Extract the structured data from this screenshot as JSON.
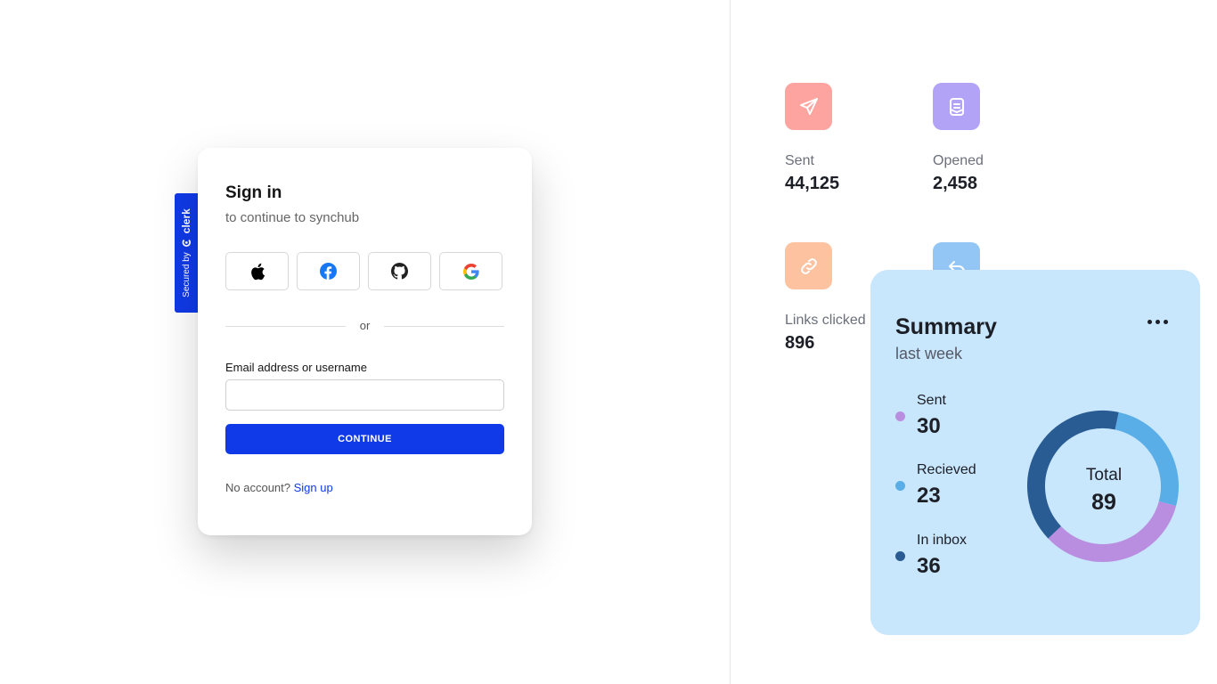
{
  "auth": {
    "badge": {
      "prefix": "Secured by",
      "brand": "clerk"
    },
    "title": "Sign in",
    "subtitle": "to continue to synchub",
    "social_providers": [
      {
        "name": "apple-icon"
      },
      {
        "name": "facebook-icon"
      },
      {
        "name": "github-icon"
      },
      {
        "name": "google-icon"
      }
    ],
    "divider_text": "or",
    "email_label": "Email address or username",
    "email_value": "",
    "continue_label": "CONTINUE",
    "no_account_text": "No account?",
    "signup_link": "Sign up",
    "colors": {
      "primary": "#103ae8"
    }
  },
  "stats": [
    {
      "label": "Sent",
      "value": "44,125",
      "icon": "paper-plane-icon",
      "color": "#fda4a1"
    },
    {
      "label": "Opened",
      "value": "2,458",
      "icon": "open-mail-icon",
      "color": "#b2a3f7"
    },
    {
      "label": "Links clicked",
      "value": "896",
      "icon": "link-icon",
      "color": "#fdc3a1"
    },
    {
      "icon": "reply-icon",
      "color": "#93c6f5"
    }
  ],
  "summary": {
    "title": "Summary",
    "subtitle": "last week",
    "items": [
      {
        "label": "Sent",
        "value": "30",
        "color": "#b98ee0"
      },
      {
        "label": "Recieved",
        "value": "23",
        "color": "#5aaee8"
      },
      {
        "label": "In inbox",
        "value": "36",
        "color": "#2a5c94"
      }
    ],
    "total_label": "Total",
    "total_value": "89"
  }
}
